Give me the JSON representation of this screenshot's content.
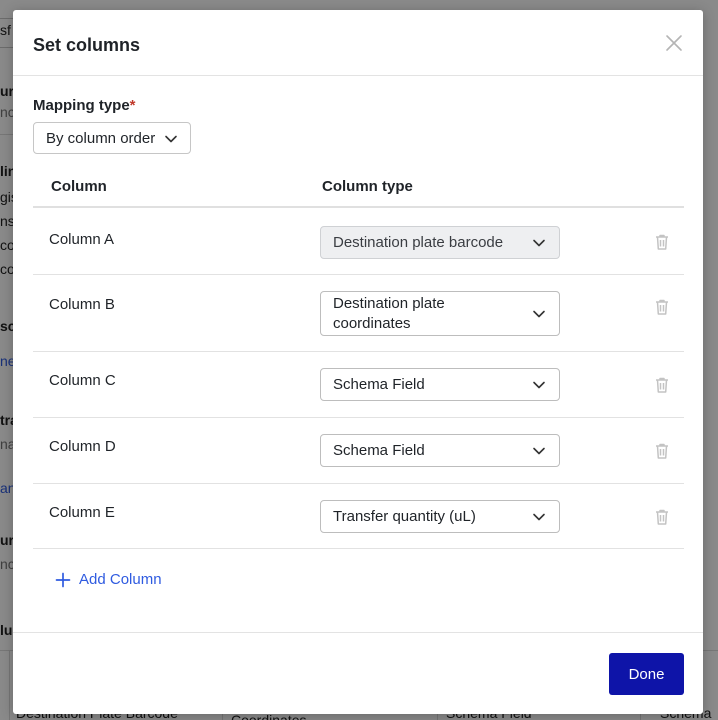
{
  "background": {
    "fragments": [
      "sf",
      "ur",
      "nc",
      "lin",
      "gis",
      "ns",
      "co",
      "co",
      "sc",
      "ne",
      "tra",
      "na",
      "ans",
      "ur",
      "nc",
      "lu",
      "Destination Plate Barcode",
      "Coordinates",
      "Schema Field",
      "Schema"
    ]
  },
  "modal": {
    "title": "Set columns",
    "mapping": {
      "label": "Mapping type",
      "required_mark": "*",
      "selected": "By column order"
    },
    "table": {
      "headers": {
        "column": "Column",
        "column_type": "Column type"
      },
      "rows": [
        {
          "column": "Column A",
          "type": "Destination plate barcode",
          "disabled": true
        },
        {
          "column": "Column B",
          "type": "Destination plate coordinates",
          "disabled": false
        },
        {
          "column": "Column C",
          "type": "Schema Field",
          "disabled": false
        },
        {
          "column": "Column D",
          "type": "Schema Field",
          "disabled": false
        },
        {
          "column": "Column E",
          "type": "Transfer quantity (uL)",
          "disabled": false
        }
      ]
    },
    "add_column_label": "Add Column",
    "done_label": "Done"
  },
  "icons": {
    "close": "close-icon",
    "chevron": "chevron-down-icon",
    "trash": "trash-icon",
    "plus": "plus-icon"
  },
  "colors": {
    "primary": "#0e14a8",
    "link": "#2f5be0",
    "required": "#c0392b"
  }
}
